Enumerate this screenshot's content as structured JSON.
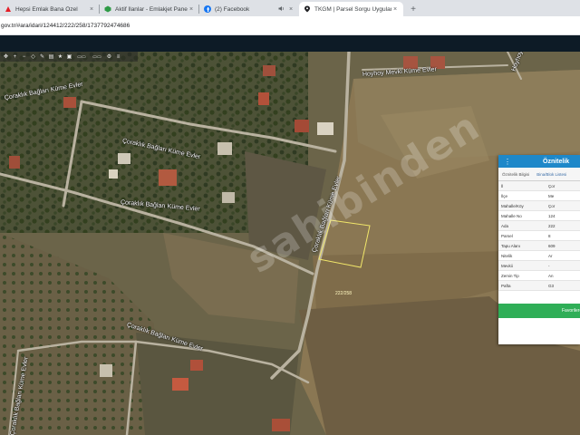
{
  "browser": {
    "tabs": [
      {
        "title": "Hepsi Emlak Bana Özel",
        "icon": "hepsiemlak-icon",
        "color": "#e41e26"
      },
      {
        "title": "Aktif İlanlar - Emlakjet Panel",
        "icon": "emlakjet-icon",
        "color": "#2e9a46"
      },
      {
        "title": "(2) Facebook",
        "icon": "facebook-icon",
        "color": "#1877f2"
      },
      {
        "title": "TKGM | Parsel Sorgu Uygulama",
        "icon": "location-pin-icon",
        "color": "#202124"
      }
    ],
    "close_glyph": "×",
    "new_tab_glyph": "+",
    "url": "gov.tr/#ara/idari/124412/222/258/1737792474686"
  },
  "map": {
    "watermark": "sahibinden",
    "parcel_label": "222/258",
    "road_labels": [
      "Çoraklık Bağları Küme Evler",
      "Çoraklık Bağları Küme Evler",
      "Çoraklık Bağları Küme Evler",
      "Çoraklık Bağları Küme Evler",
      "Çoraklık Bağları Küme Evler",
      "Çoraklık Bağları Küme Evler",
      "Hoyhoy Mevki Küme Evler",
      "Hoyhoy"
    ]
  },
  "panel": {
    "title": "Öznitelik",
    "tabs": [
      "Öznitelik Bilgisi",
      "Bina/Blok Listesi"
    ],
    "rows": [
      {
        "key": "İl",
        "value": "Çor"
      },
      {
        "key": "İlçe",
        "value": "Me"
      },
      {
        "key": "Mahalle/Köy",
        "value": "Çor"
      },
      {
        "key": "Mahalle No",
        "value": "124"
      },
      {
        "key": "Ada",
        "value": "222"
      },
      {
        "key": "Parsel",
        "value": "8"
      },
      {
        "key": "Tapu Alanı",
        "value": "609"
      },
      {
        "key": "Nitelik",
        "value": "Ar"
      },
      {
        "key": "Mevkii",
        "value": "-"
      },
      {
        "key": "Zemin Tip",
        "value": "An"
      },
      {
        "key": "Pafta",
        "value": "G3"
      }
    ],
    "button": "Favorilere"
  },
  "colors": {
    "header": "#0d1b26",
    "panel_header": "#1e88c9",
    "panel_button": "#2fae57"
  }
}
